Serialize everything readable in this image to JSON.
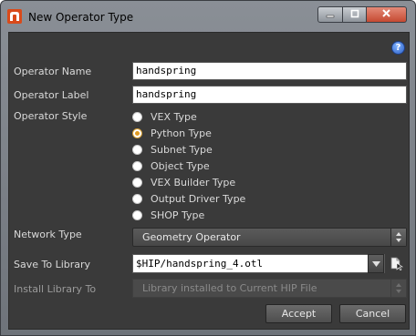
{
  "window": {
    "title": "New Operator Type",
    "icon": "houdini-app-icon",
    "controls": [
      "minimize-icon",
      "maximize-icon",
      "close-icon"
    ]
  },
  "help": {
    "icon": "help-icon",
    "glyph": "?"
  },
  "form": {
    "operator_name": {
      "label": "Operator Name",
      "value": "handspring"
    },
    "operator_label": {
      "label": "Operator Label",
      "value": "handspring"
    },
    "operator_style": {
      "label": "Operator Style",
      "options": [
        {
          "label": "VEX Type",
          "checked": false
        },
        {
          "label": "Python Type",
          "checked": true
        },
        {
          "label": "Subnet Type",
          "checked": false
        },
        {
          "label": "Object Type",
          "checked": false
        },
        {
          "label": "VEX Builder Type",
          "checked": false
        },
        {
          "label": "Output Driver Type",
          "checked": false
        },
        {
          "label": "SHOP Type",
          "checked": false
        }
      ]
    },
    "network_type": {
      "label": "Network Type",
      "value": "Geometry Operator"
    },
    "save_to_library": {
      "label": "Save To Library",
      "value": "$HIP/handspring_4.otl"
    },
    "install_library_to": {
      "label": "Install Library To",
      "value": "Library installed to Current HIP File"
    }
  },
  "buttons": {
    "accept": "Accept",
    "cancel": "Cancel"
  },
  "colors": {
    "panel_bg": "#3a3a3a",
    "radio_selected": "#e09a20",
    "titlebar": "#8a8f96",
    "close_button": "#c54a32"
  }
}
